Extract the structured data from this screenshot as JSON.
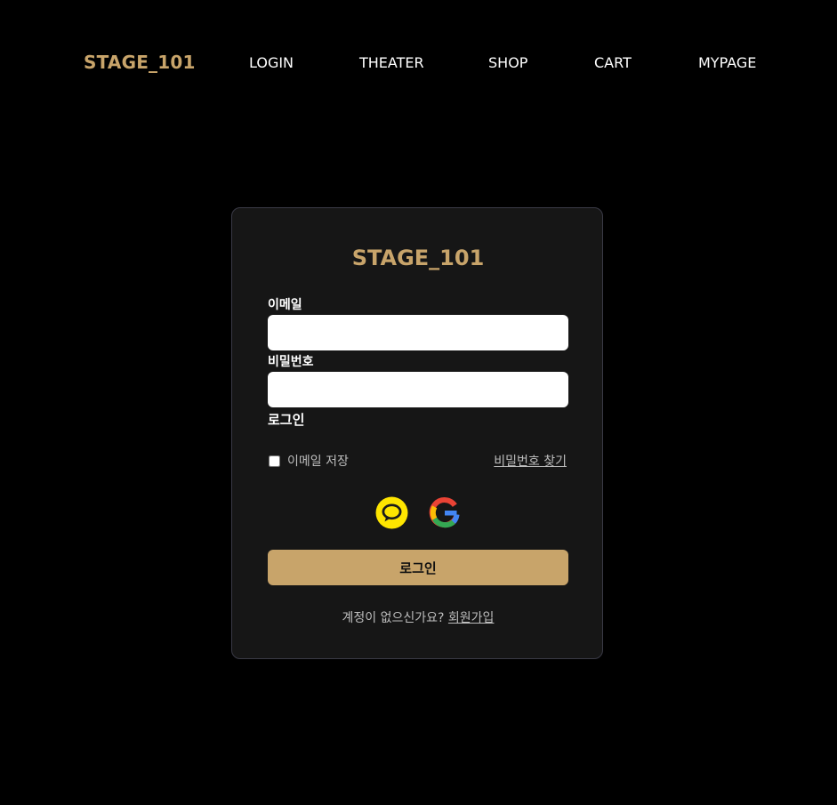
{
  "nav": {
    "brand": "STAGE_101",
    "links": [
      "LOGIN",
      "THEATER",
      "SHOP",
      "CART",
      "MYPAGE"
    ]
  },
  "login_card": {
    "title": "STAGE_101",
    "email_label": "이메일",
    "email_value": "",
    "password_label": "비밀번호",
    "password_value": "",
    "inline_label": "로그인",
    "remember_email_label": "이메일 저장",
    "remember_email_checked": false,
    "find_password_link": "비밀번호 찾기",
    "social_buttons": [
      {
        "icon": "kakao-icon"
      },
      {
        "icon": "google-icon"
      }
    ],
    "submit_label": "로그인",
    "signup_prompt": "계정이 없으신가요?",
    "signup_link": "회원가입"
  },
  "colors": {
    "accent": "#c8a46a",
    "background": "#000000",
    "card_background": "#161616",
    "card_border": "#3a3a46",
    "kakao_yellow": "#fee500"
  }
}
